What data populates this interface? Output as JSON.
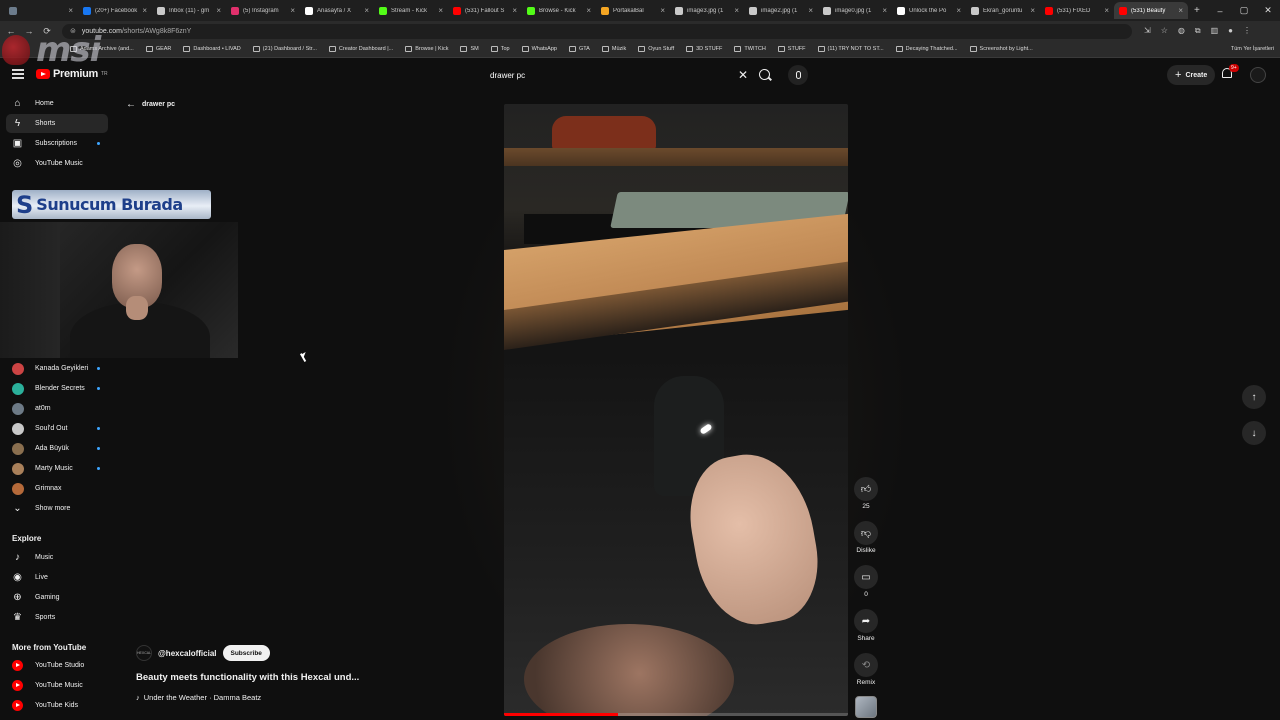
{
  "browser": {
    "tabs": [
      {
        "label": "",
        "color": "#6c7c8c"
      },
      {
        "label": "(20+) Facebook",
        "color": "#1877f2"
      },
      {
        "label": "Inbox (11) - gm",
        "color": "#c9c9c9"
      },
      {
        "label": "(5) Instagram",
        "color": "#e1306c"
      },
      {
        "label": "Anasayfa / X",
        "color": "#ffffff"
      },
      {
        "label": "Stream - Kick",
        "color": "#53fc18"
      },
      {
        "label": "(531) Fallout S",
        "color": "#ff0000"
      },
      {
        "label": "Browse - Kick",
        "color": "#53fc18"
      },
      {
        "label": "PortakalBal",
        "color": "#f5a623"
      },
      {
        "label": "image3.jpg (1",
        "color": "#c9c9c9"
      },
      {
        "label": "image2.jpg (1",
        "color": "#c9c9c9"
      },
      {
        "label": "image0.jpg (1",
        "color": "#c9c9c9"
      },
      {
        "label": "Unlock the Po",
        "color": "#ffffff"
      },
      {
        "label": "Ekran_goruntu",
        "color": "#c9c9c9"
      },
      {
        "label": "(531) FIXED",
        "color": "#ff0000"
      },
      {
        "label": "(531) Beauty",
        "color": "#ff0000",
        "active": true
      }
    ],
    "url": "youtube.com",
    "url_path": "/shorts/AWg8k8F6znY",
    "bookmarks": [
      "Adams Archive (and...",
      "GEAR",
      "Dashboard • LIVAD",
      "(21) Dashboard / Str...",
      "Creator Dashboard |...",
      "Browse | Kick",
      "SM",
      "Top",
      "WhatsApp",
      "GTA",
      "Müzik",
      "Oyun Stuff",
      "3D STUFF",
      "TWITCH",
      "STUFF",
      "(11) TRY NOT TO ST...",
      "Decaying Thatched...",
      "Screenshot by Light..."
    ],
    "bookmarks_right": "Tüm Yer İşaretleri"
  },
  "watermark": "msi",
  "header": {
    "logo_text": "Premium",
    "logo_tm": "TR",
    "search_value": "drawer pc",
    "create_label": "Create",
    "notif_badge": "9+"
  },
  "sidebar": {
    "main": [
      {
        "label": "Home",
        "icon": "home-icon"
      },
      {
        "label": "Shorts",
        "icon": "shorts-icon",
        "active": true
      },
      {
        "label": "Subscriptions",
        "icon": "subscriptions-icon",
        "dot": true
      },
      {
        "label": "YouTube Music",
        "icon": "music-icon"
      }
    ],
    "channels": [
      {
        "label": "Kanada Geyikleri",
        "dot": true,
        "color": "#c44"
      },
      {
        "label": "Blender Secrets",
        "dot": true,
        "color": "#2bb09b"
      },
      {
        "label": "at0m",
        "dot": false,
        "color": "#6d7a86"
      },
      {
        "label": "Soul'd Out",
        "dot": true,
        "color": "#c9c9c9"
      },
      {
        "label": "Ada Büyük",
        "dot": true,
        "color": "#8a6f4f"
      },
      {
        "label": "Marty Music",
        "dot": true,
        "color": "#a9805a"
      },
      {
        "label": "Grimnax",
        "dot": false,
        "color": "#b56a3a"
      }
    ],
    "show_more": "Show more",
    "explore_title": "Explore",
    "explore": [
      {
        "label": "Music",
        "icon": "music-note-icon"
      },
      {
        "label": "Live",
        "icon": "live-icon"
      },
      {
        "label": "Gaming",
        "icon": "gaming-icon"
      },
      {
        "label": "Sports",
        "icon": "trophy-icon"
      }
    ],
    "more_title": "More from YouTube",
    "more": [
      {
        "label": "YouTube Studio"
      },
      {
        "label": "YouTube Music"
      },
      {
        "label": "YouTube Kids"
      }
    ]
  },
  "overlay": {
    "banner_text": "Sunucum Burada",
    "banner_s": "S"
  },
  "shorts": {
    "query": "drawer pc",
    "like_count": "25",
    "dislike_label": "Dislike",
    "comment_count": "0",
    "share_label": "Share",
    "remix_label": "Remix",
    "channel_avatar_text": "HEXCAL",
    "channel_handle": "@hexcalofficial",
    "subscribe_label": "Subscribe",
    "title": "Beauty meets functionality with this Hexcal und...",
    "music_note": "♪",
    "music": "Under the Weather · Damma Beatz",
    "progress": 0.33
  }
}
